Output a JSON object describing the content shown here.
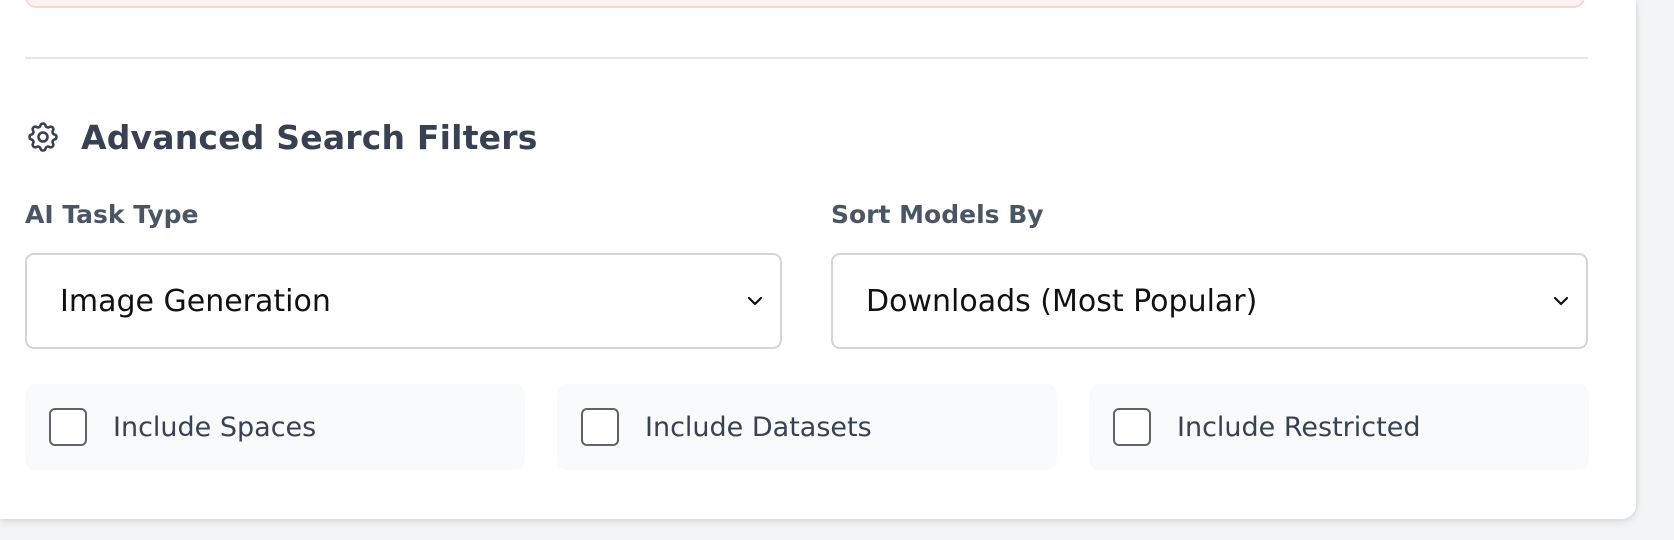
{
  "filters": {
    "title": "Advanced Search Filters",
    "icon": "gear-icon",
    "task_type": {
      "label": "AI Task Type",
      "selected": "Image Generation"
    },
    "sort_by": {
      "label": "Sort Models By",
      "selected": "Downloads (Most Popular)"
    },
    "checkboxes": [
      {
        "label": "Include Spaces",
        "checked": false
      },
      {
        "label": "Include Datasets",
        "checked": false
      },
      {
        "label": "Include Restricted",
        "checked": false
      }
    ]
  },
  "colors": {
    "heading": "#374151",
    "label": "#4b5563",
    "border": "#d1d5db",
    "checkbox_card_bg": "#f9fafb",
    "error_border": "#fbd5d5",
    "error_bg": "#fef2f2"
  }
}
